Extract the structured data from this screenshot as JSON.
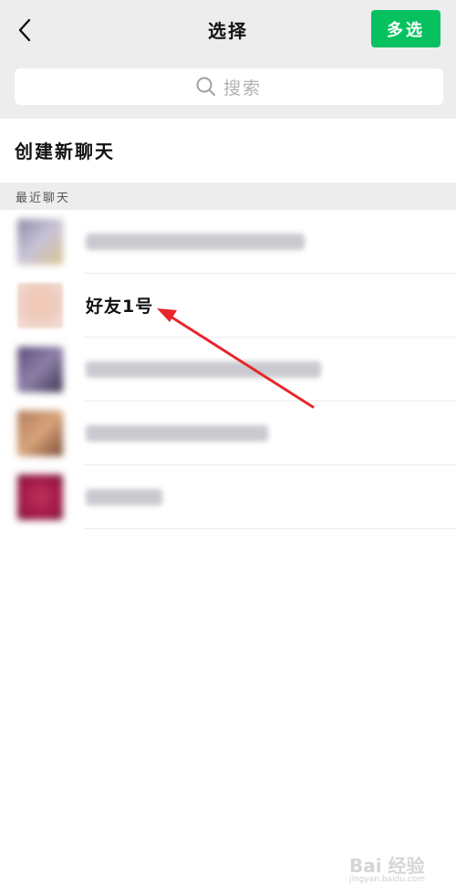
{
  "header": {
    "title": "选择",
    "multi_select_label": "多选"
  },
  "search": {
    "placeholder": "搜索"
  },
  "new_chat": {
    "label": "创建新聊天"
  },
  "section": {
    "recent_chats_label": "最近聊天"
  },
  "chats": [
    {
      "name": "",
      "blurred": true
    },
    {
      "name": "好友1号",
      "blurred": false
    },
    {
      "name": "",
      "blurred": true
    },
    {
      "name": "",
      "blurred": true
    },
    {
      "name": "",
      "blurred": true
    }
  ],
  "colors": {
    "accent": "#07c160",
    "annotation": "#e8262a",
    "header_bg": "#ededed"
  },
  "watermark": {
    "logo_text": "Bai 经验",
    "url": "jingyan.baidu.com"
  }
}
